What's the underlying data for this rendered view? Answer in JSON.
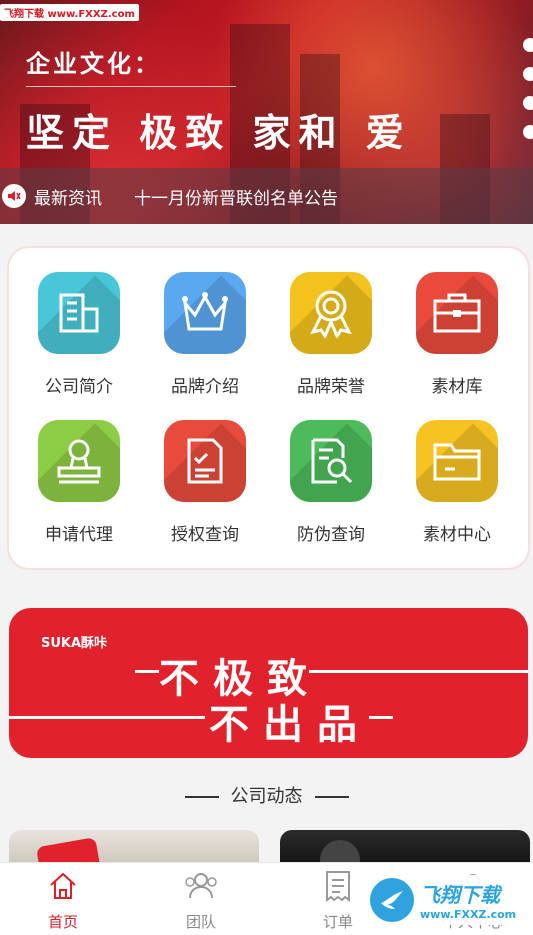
{
  "watermark_top": "飞翔下载 www.FXXZ.com",
  "banner": {
    "title": "企业文化：",
    "slogan": "坚定 极致 家和 爱"
  },
  "news_ticker": {
    "label": "最新资讯",
    "headline": "十一月份新晋联创名单公告"
  },
  "grid": [
    {
      "label": "公司简介",
      "icon": "building-icon",
      "color": "#49c7d8"
    },
    {
      "label": "品牌介绍",
      "icon": "crown-icon",
      "color": "#5aa8f0"
    },
    {
      "label": "品牌荣誉",
      "icon": "award-ribbon-icon",
      "color": "#f3c21d"
    },
    {
      "label": "素材库",
      "icon": "briefcase-icon",
      "color": "#ea4a3c"
    },
    {
      "label": "申请代理",
      "icon": "stamp-icon",
      "color": "#8dcc45"
    },
    {
      "label": "授权查询",
      "icon": "checklist-icon",
      "color": "#e84a3c"
    },
    {
      "label": "防伪查询",
      "icon": "document-search-icon",
      "color": "#4dbb5b"
    },
    {
      "label": "素材中心",
      "icon": "folder-icon",
      "color": "#f6c323"
    }
  ],
  "promo": {
    "brand": "SUKA酥咔",
    "line1": "不极致",
    "line2": "不出品"
  },
  "section": {
    "title": "公司动态"
  },
  "tabbar": [
    {
      "label": "首页",
      "icon": "home-icon",
      "active": true
    },
    {
      "label": "团队",
      "icon": "team-icon",
      "active": false
    },
    {
      "label": "订单",
      "icon": "order-icon",
      "active": false
    },
    {
      "label": "个人中心",
      "icon": "user-icon",
      "active": false
    }
  ],
  "watermark_bottom": {
    "name": "飞翔下载",
    "url": "www.FXXZ.com"
  },
  "colors": {
    "accent": "#d6222a",
    "promo_red": "#e1222d"
  }
}
